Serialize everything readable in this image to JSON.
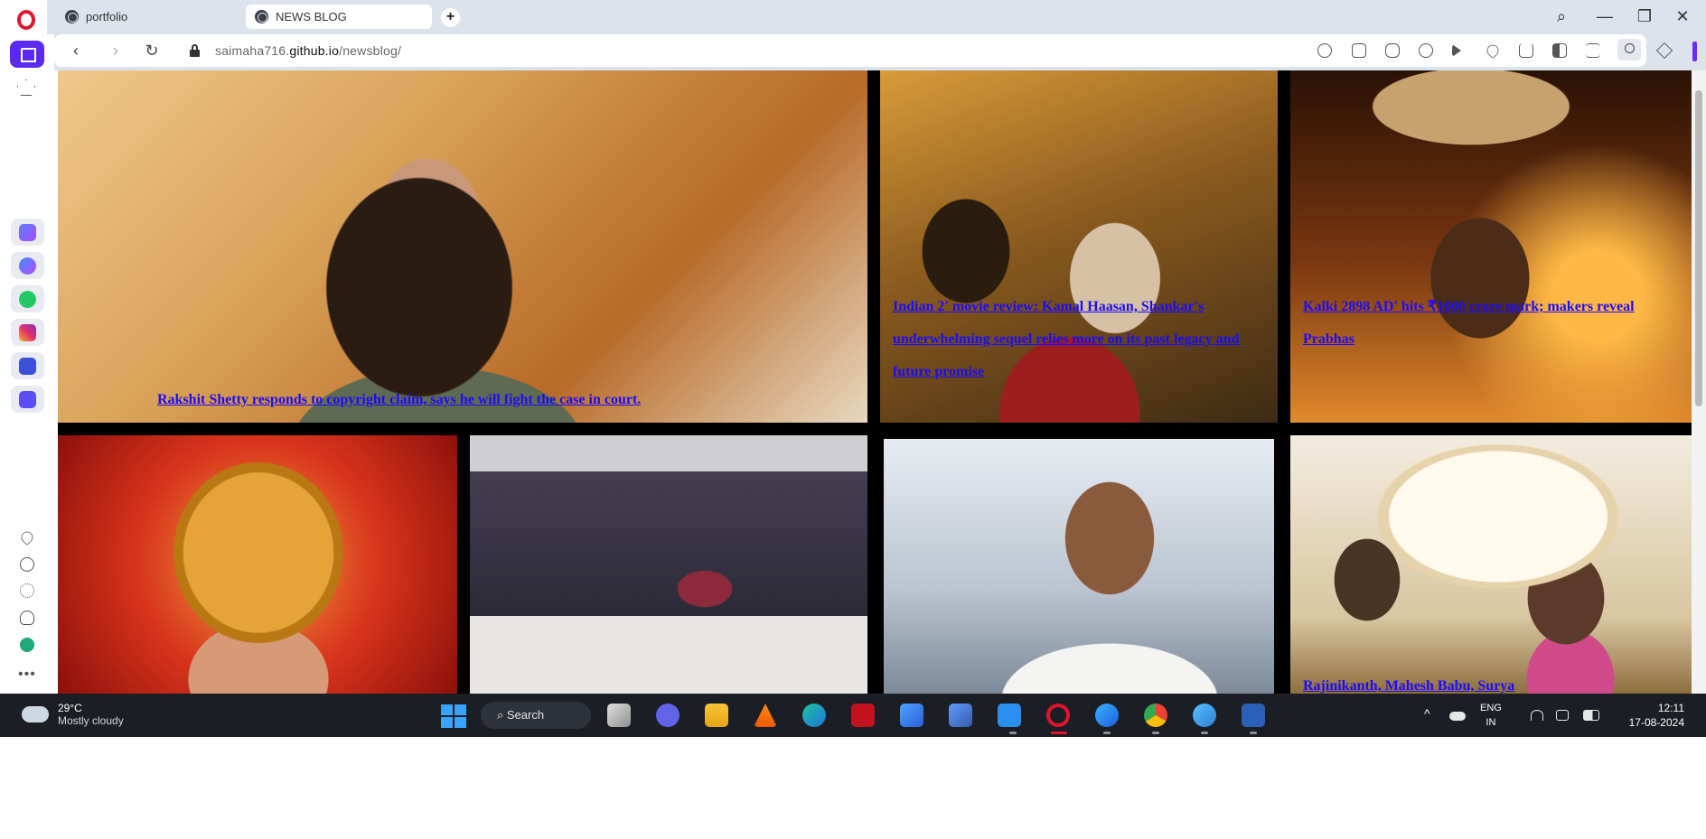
{
  "browser": {
    "tabs": [
      {
        "title": "portfolio",
        "active": false
      },
      {
        "title": "NEWS BLOG",
        "active": true
      }
    ],
    "new_tab_label": "+",
    "url_prefix": "saimaha716.",
    "url_host": "github.io",
    "url_path": "/newsblog/",
    "nav": {
      "back": "‹",
      "forward": "›",
      "reload": "↻"
    },
    "window_controls": {
      "search": "⌕",
      "minimize": "—",
      "restore": "❐",
      "close": "✕"
    }
  },
  "news": [
    {
      "headline": "Rakshit Shetty responds to copyright claim, says he will fight the case in court.",
      "palette": [
        "#b86a28",
        "#d9a35a",
        "#f0c88a"
      ]
    },
    {
      "headline": "Indian 2' movie review: Kamal Haasan, Shankar's underwhelming sequel relies more on its past legacy and future promise",
      "palette": [
        "#3d2a14",
        "#8a5a1e",
        "#d99b3a"
      ]
    },
    {
      "headline": "Kalki 2898 AD' hits ₹1000 crore mark; makers reveal Prabhas",
      "palette": [
        "#2a1206",
        "#7a3710",
        "#e08a2c"
      ]
    },
    {
      "headline": "",
      "palette": [
        "#8a0f0a",
        "#d8341c",
        "#f1a53a"
      ]
    },
    {
      "headline": "",
      "palette": [
        "#1e1d28",
        "#4a4458",
        "#cfcfd2"
      ]
    },
    {
      "headline": "",
      "palette": [
        "#e7ecf2",
        "#b9c3cf",
        "#7a8796"
      ]
    },
    {
      "headline": "Rajinikanth, Mahesh Babu, Surya",
      "palette": [
        "#f3ecdf",
        "#d8c6a0",
        "#8a6a3a"
      ]
    }
  ],
  "taskbar": {
    "weather_temp": "29°C",
    "weather_desc": "Mostly cloudy",
    "search_label": "Search",
    "lang_top": "ENG",
    "lang_bottom": "IN",
    "time": "12:11",
    "date": "17-08-2024",
    "tray_chevron": "^"
  },
  "colors": {
    "link": "#1d0cf7",
    "accent": "#5b29f0",
    "opera_red": "#e0142c",
    "taskbar": "#1b1e24"
  }
}
